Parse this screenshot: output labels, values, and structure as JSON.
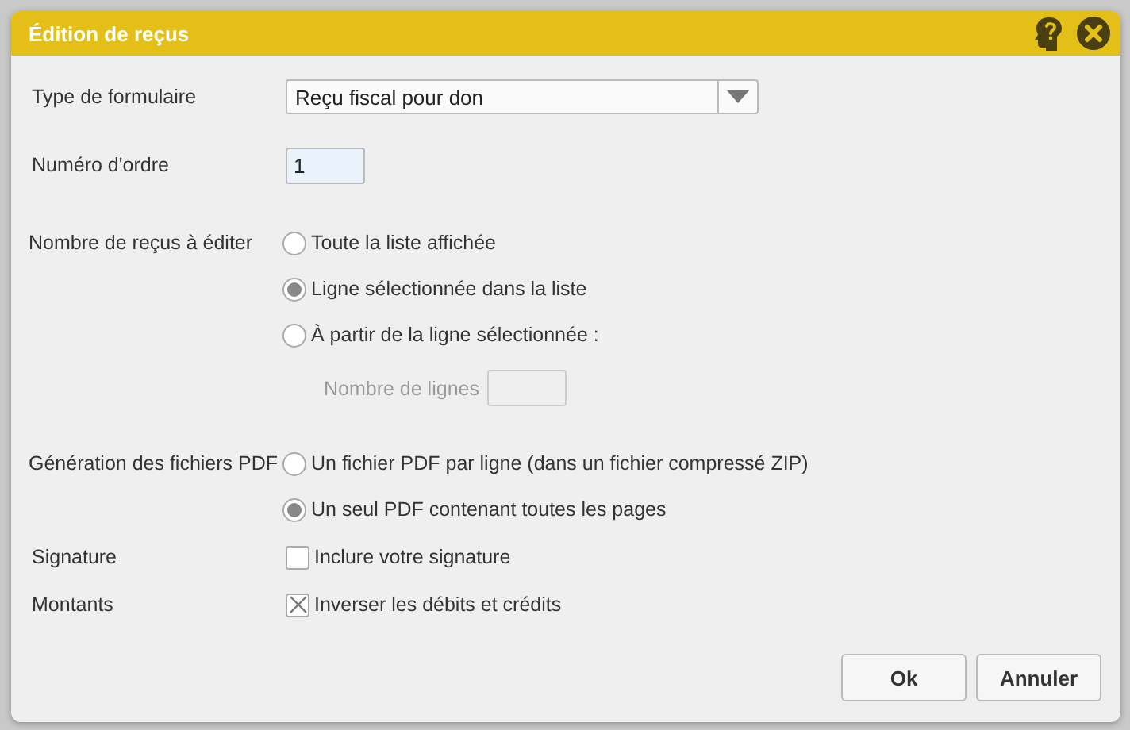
{
  "dialog": {
    "title": "Édition de reçus"
  },
  "form_type": {
    "label": "Type de formulaire",
    "value": "Reçu fiscal pour don"
  },
  "order_number": {
    "label": "Numéro d'ordre",
    "value": "1"
  },
  "receipt_count": {
    "label": "Nombre de reçus à éditer",
    "options": [
      {
        "label": "Toute la liste affichée",
        "selected": false
      },
      {
        "label": "Ligne sélectionnée dans la liste",
        "selected": true
      },
      {
        "label": "À partir de la ligne sélectionnée :",
        "selected": false
      }
    ],
    "line_count": {
      "label": "Nombre de lignes",
      "disabled": true
    }
  },
  "pdf_generation": {
    "label": "Génération des fichiers PDF",
    "options": [
      {
        "label": "Un fichier PDF par ligne (dans un fichier compressé ZIP)",
        "selected": false
      },
      {
        "label": "Un seul PDF contenant toutes les pages",
        "selected": true
      }
    ]
  },
  "checkboxes": [
    {
      "label": "Signature",
      "option": "Inclure votre signature",
      "checked": false
    },
    {
      "label": "Montants",
      "option": "Inverser les débits et crédits",
      "checked": true
    }
  ],
  "buttons": [
    "Ok",
    "Annuler"
  ]
}
